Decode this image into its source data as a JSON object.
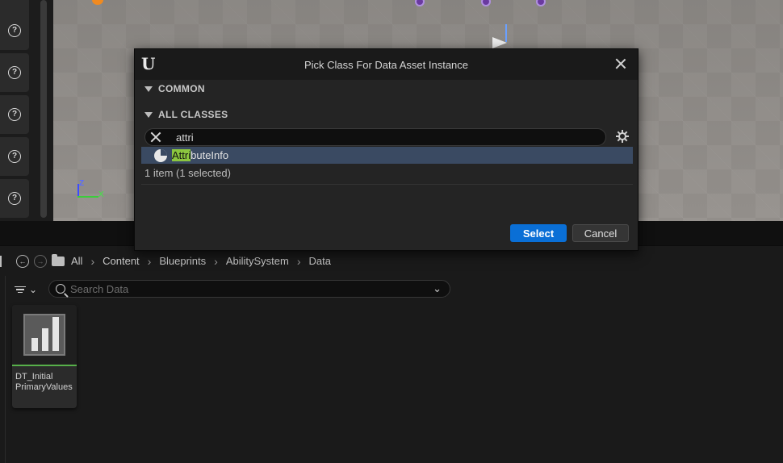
{
  "dialog": {
    "title": "Pick Class For Data Asset Instance",
    "sections": {
      "common": "COMMON",
      "all_classes": "ALL CLASSES"
    },
    "search_value": "attri",
    "result": {
      "match": "Attri",
      "rest": "buteInfo"
    },
    "count_text": "1 item (1 selected)",
    "select_label": "Select",
    "cancel_label": "Cancel"
  },
  "breadcrumb": [
    "All",
    "Content",
    "Blueprints",
    "AbilitySystem",
    "Data"
  ],
  "content_browser": {
    "search_placeholder": "Search Data",
    "assets": [
      {
        "name_line1": "DT_Initial",
        "name_line2": "PrimaryValues"
      }
    ]
  },
  "viewport": {
    "axis_z": "Z",
    "axis_x": "X"
  },
  "left_toolbar": {
    "help_glyph": "?"
  },
  "colors": {
    "select_button": "#0a6fd6",
    "highlight": "#8cc63f",
    "selected_row": "#3a4a62"
  }
}
